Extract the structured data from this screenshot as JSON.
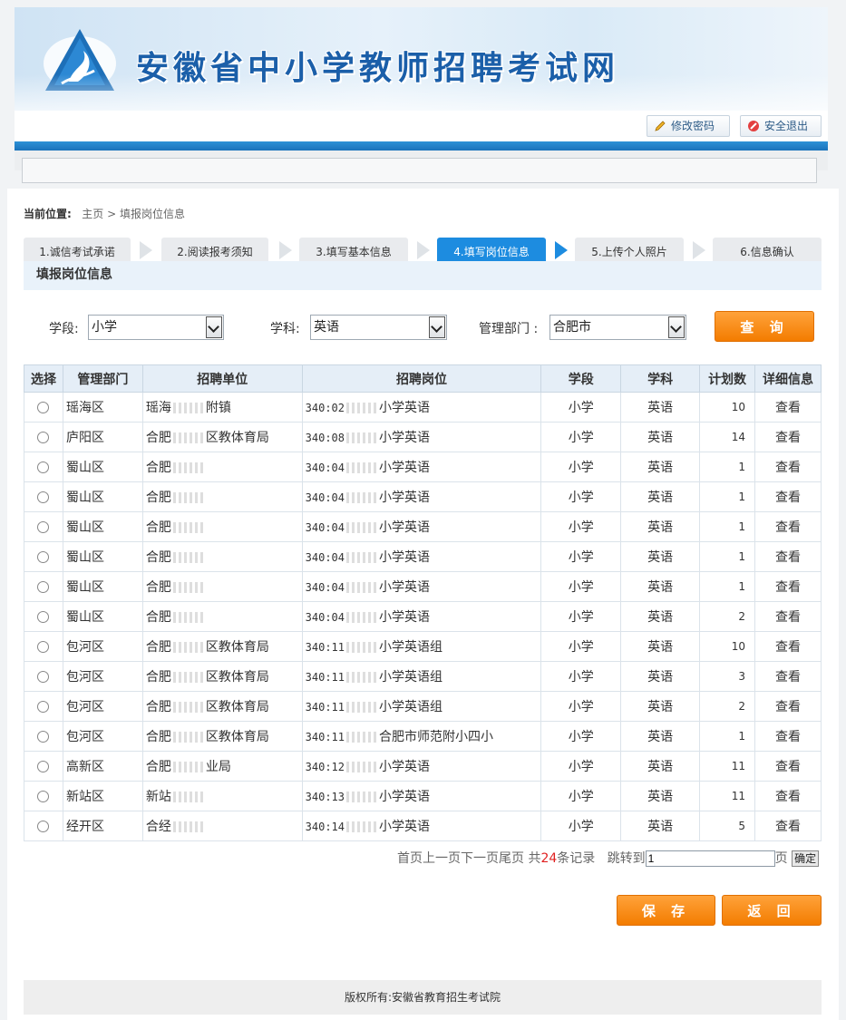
{
  "header": {
    "site_title": "安徽省中小学教师招聘考试网",
    "change_password": "修改密码",
    "logout": "安全退出"
  },
  "breadcrumb": {
    "label": "当前位置:",
    "home": "主页",
    "sep": ">",
    "current": "填报岗位信息"
  },
  "steps": [
    {
      "label": "1.诚信考试承诺"
    },
    {
      "label": "2.阅读报考须知"
    },
    {
      "label": "3.填写基本信息"
    },
    {
      "label": "4.填写岗位信息"
    },
    {
      "label": "5.上传个人照片"
    },
    {
      "label": "6.信息确认"
    }
  ],
  "section_title": "填报岗位信息",
  "filters": {
    "stage_label": "学段:",
    "stage_value": "小学",
    "subject_label": "学科:",
    "subject_value": "英语",
    "dept_label": "管理部门 :",
    "dept_value": "合肥市",
    "query": "查 询"
  },
  "table": {
    "headers": [
      "选择",
      "管理部门",
      "招聘单位",
      "招聘岗位",
      "学段",
      "学科",
      "计划数",
      "详细信息"
    ],
    "rows": [
      {
        "dept": "瑶海区",
        "unit": "瑶海",
        "unit2": "附",
        "unit3": "镇",
        "code": "340:02",
        "post": "小学英语",
        "stage": "小学",
        "subject": "英语",
        "plan": "10",
        "detail": "查看"
      },
      {
        "dept": "庐阳区",
        "unit": "合肥",
        "unit2": "区教体育局",
        "unit3": "",
        "code": "340:08",
        "post": "小学英语",
        "stage": "小学",
        "subject": "英语",
        "plan": "14",
        "detail": "查看"
      },
      {
        "dept": "蜀山区",
        "unit": "合肥",
        "unit2": "",
        "unit3": "",
        "code": "340:04",
        "post": "小学英语",
        "stage": "小学",
        "subject": "英语",
        "plan": "1",
        "detail": "查看"
      },
      {
        "dept": "蜀山区",
        "unit": "合肥",
        "unit2": "",
        "unit3": "",
        "code": "340:04",
        "post": "小学英语",
        "stage": "小学",
        "subject": "英语",
        "plan": "1",
        "detail": "查看"
      },
      {
        "dept": "蜀山区",
        "unit": "合肥",
        "unit2": "",
        "unit3": "",
        "code": "340:04",
        "post": "小学英语",
        "stage": "小学",
        "subject": "英语",
        "plan": "1",
        "detail": "查看"
      },
      {
        "dept": "蜀山区",
        "unit": "合肥",
        "unit2": "",
        "unit3": "",
        "code": "340:04",
        "post": "小学英语",
        "stage": "小学",
        "subject": "英语",
        "plan": "1",
        "detail": "查看"
      },
      {
        "dept": "蜀山区",
        "unit": "合肥",
        "unit2": "",
        "unit3": "",
        "code": "340:04",
        "post": "小学英语",
        "stage": "小学",
        "subject": "英语",
        "plan": "1",
        "detail": "查看"
      },
      {
        "dept": "蜀山区",
        "unit": "合肥",
        "unit2": "",
        "unit3": "",
        "code": "340:04",
        "post": "小学英语",
        "stage": "小学",
        "subject": "英语",
        "plan": "2",
        "detail": "查看"
      },
      {
        "dept": "包河区",
        "unit": "合肥",
        "unit2": "区教体育局",
        "unit3": "",
        "code": "340:11",
        "post": "小学英语组",
        "stage": "小学",
        "subject": "英语",
        "plan": "10",
        "detail": "查看"
      },
      {
        "dept": "包河区",
        "unit": "合肥",
        "unit2": "区教体育局",
        "unit3": "",
        "code": "340:11",
        "post": "小学英语组",
        "stage": "小学",
        "subject": "英语",
        "plan": "3",
        "detail": "查看"
      },
      {
        "dept": "包河区",
        "unit": "合肥",
        "unit2": "区教体育局",
        "unit3": "",
        "code": "340:11",
        "post": "小学英语组",
        "stage": "小学",
        "subject": "英语",
        "plan": "2",
        "detail": "查看"
      },
      {
        "dept": "包河区",
        "unit": "合肥",
        "unit2": "区教体育局",
        "unit3": "",
        "code": "340:11",
        "post": "合肥市师范附小四小",
        "stage": "小学",
        "subject": "英语",
        "plan": "1",
        "detail": "查看"
      },
      {
        "dept": "高新区",
        "unit": "合肥",
        "unit2": "业局",
        "unit3": "",
        "code": "340:12",
        "post": "小学英语",
        "stage": "小学",
        "subject": "英语",
        "plan": "11",
        "detail": "查看"
      },
      {
        "dept": "新站区",
        "unit": "新站",
        "unit2": "",
        "unit3": "",
        "code": "340:13",
        "post": "小学英语",
        "stage": "小学",
        "subject": "英语",
        "plan": "11",
        "detail": "查看"
      },
      {
        "dept": "经开区",
        "unit": "合经",
        "unit2": "",
        "unit3": "",
        "code": "340:14",
        "post": "小学英语",
        "stage": "小学",
        "subject": "英语",
        "plan": "5",
        "detail": "查看"
      }
    ]
  },
  "pager": {
    "nav": "首页上一页下一页尾页",
    "total_prefix": "共",
    "total_count": "24",
    "total_suffix": "条记录",
    "jump_label": "跳转到",
    "jump_value": "1",
    "page_unit": "页",
    "confirm": "确定"
  },
  "actions": {
    "save": "保 存",
    "back": "返 回"
  },
  "footer": "版权所有:安徽省教育招生考试院",
  "colors": {
    "accent_blue": "#1d8ce0",
    "orange": "#f37c00",
    "red_count": "#e02020"
  }
}
